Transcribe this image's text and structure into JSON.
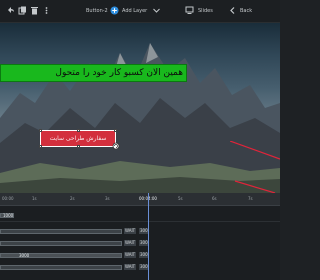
{
  "toolbar": {
    "button_name": "Button-2",
    "add_layer_label": "Add Layer",
    "slides_label": "Slides",
    "back_label": "Back"
  },
  "canvas": {
    "banner_text": "همین الان کسبو کار خود را متحول",
    "button_text": "سفارش طراحی سایت"
  },
  "timeline": {
    "ruler": [
      "00:00",
      "1s",
      "2s",
      "3s",
      "00:04:00",
      "5s",
      "6s",
      "7s"
    ],
    "rows": [
      {
        "clip_label": "1000",
        "tags": []
      },
      {
        "clip_label": "",
        "tags": [
          "WAIT",
          "300"
        ]
      },
      {
        "clip_label": "",
        "tags": [
          "WAIT",
          "300"
        ]
      },
      {
        "clip_label": "3000",
        "tags": [
          "WAIT",
          "300"
        ]
      },
      {
        "clip_label": "",
        "tags": [
          "WAIT",
          "300"
        ]
      }
    ]
  },
  "colors": {
    "banner": "#19b81d",
    "button": "#d32f3d",
    "playhead": "#6a8fd6",
    "accent_line": "#e0243a"
  }
}
